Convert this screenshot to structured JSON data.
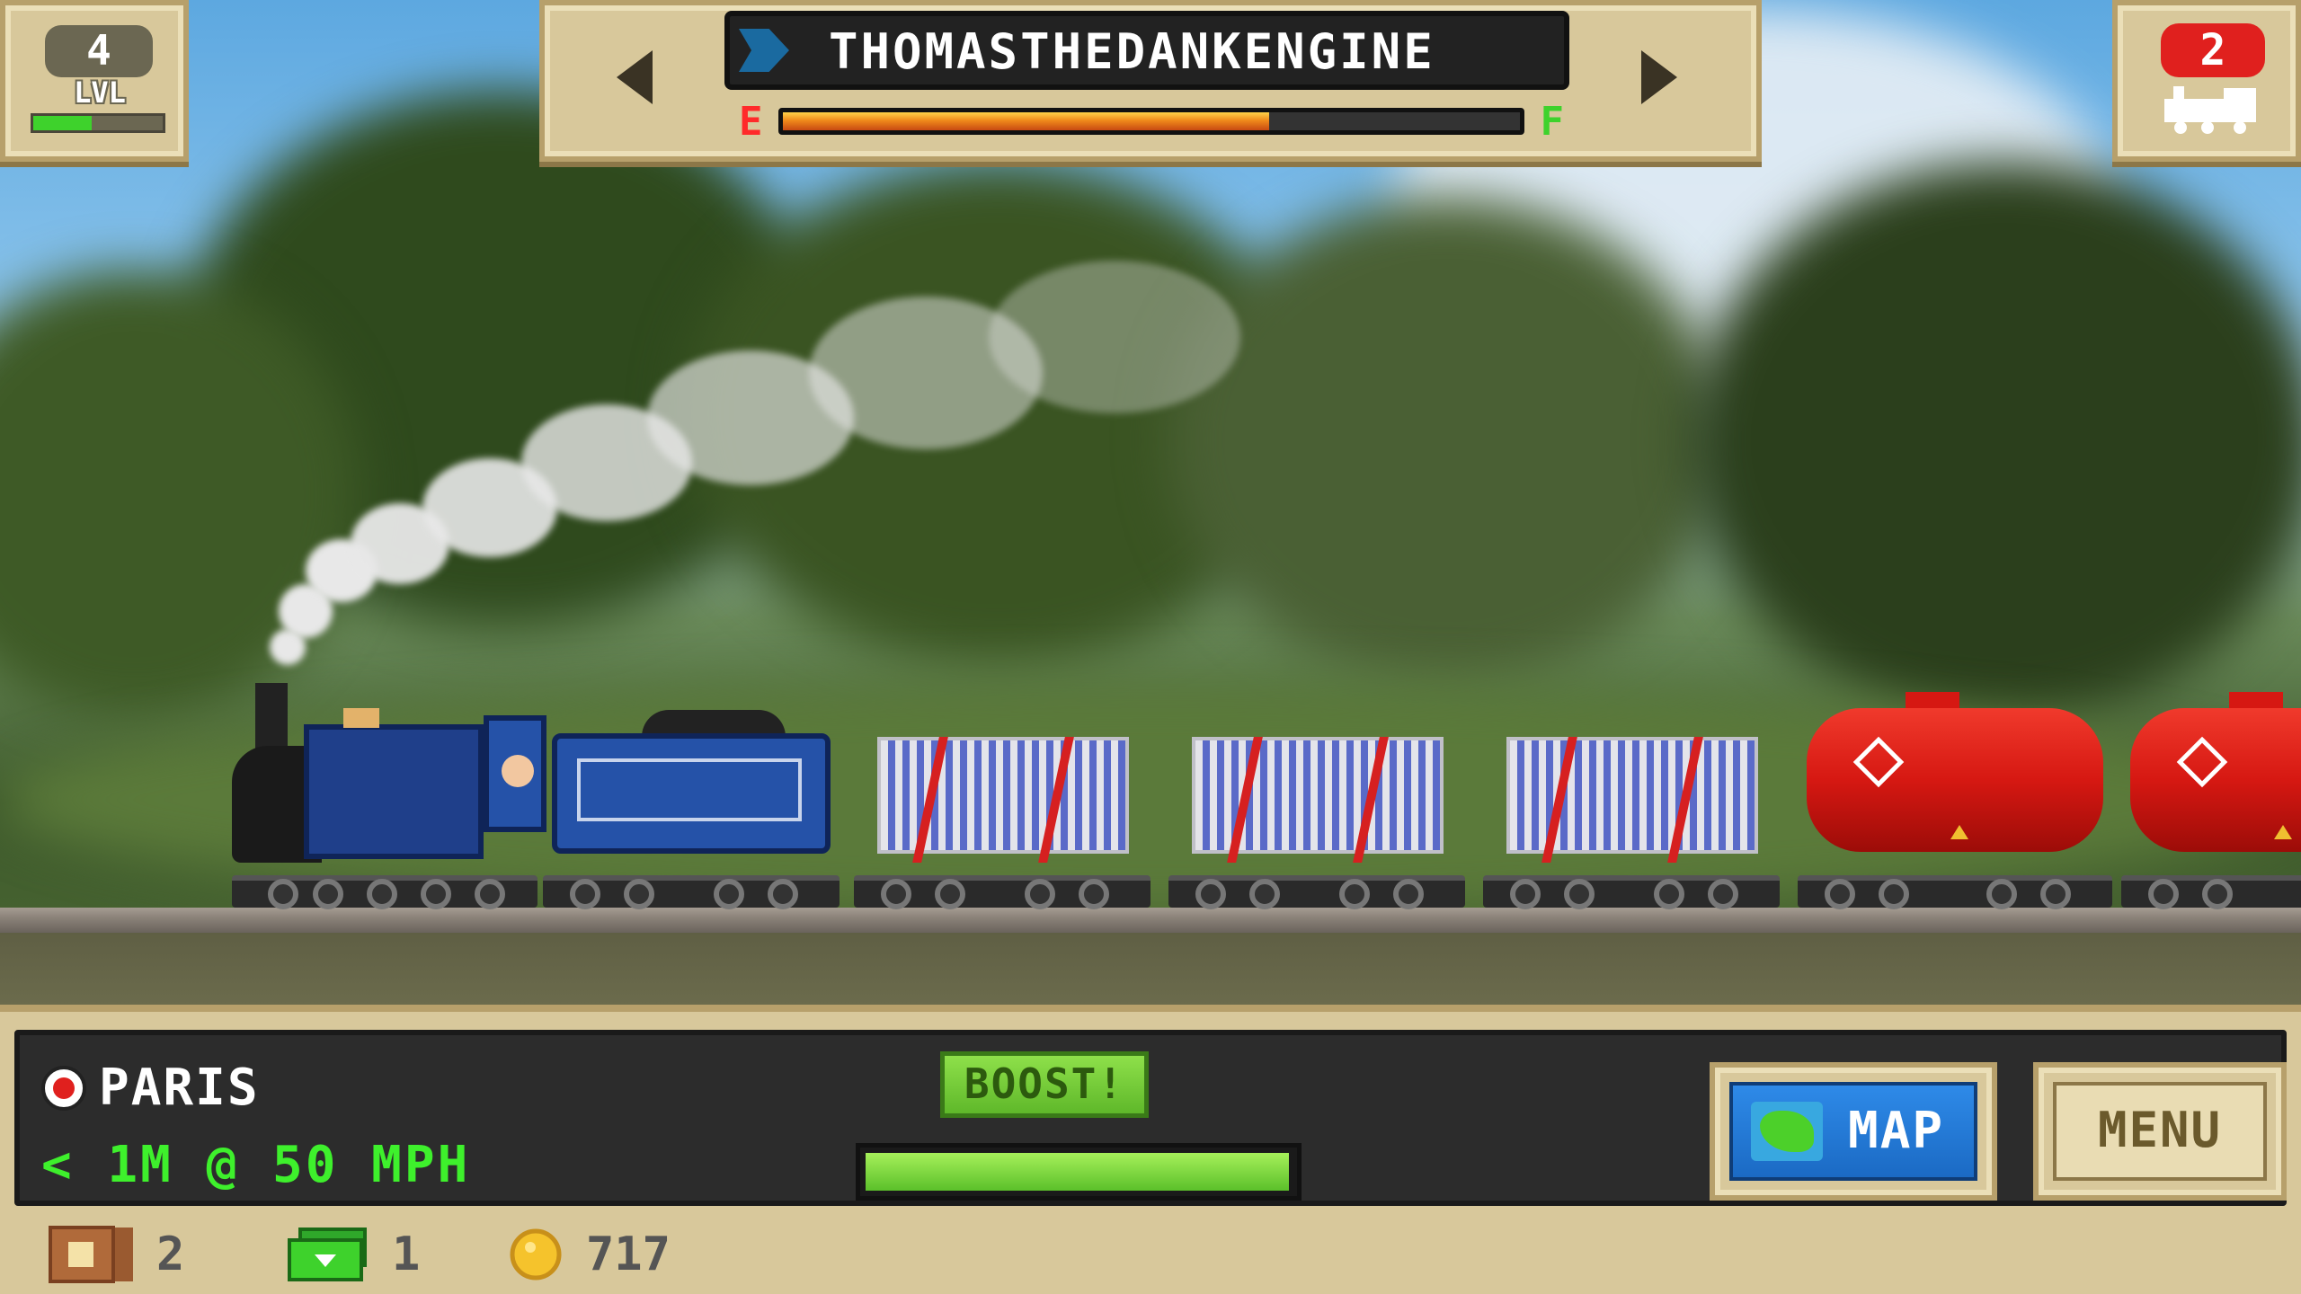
{
  "level": {
    "value": "4",
    "label": "LVL",
    "progress": 0.45
  },
  "train": {
    "name": "THOMASTHEDANKENGINE",
    "fuel_empty_label": "E",
    "fuel_full_label": "F",
    "fuel_level": 0.66
  },
  "train_count": {
    "value": "2"
  },
  "destination": {
    "name": "PARIS",
    "status": "< 1M @ 50 MPH"
  },
  "boost": {
    "label": "BOOST!",
    "level": 0.97
  },
  "buttons": {
    "map_label": "MAP",
    "menu_label": "MENU"
  },
  "resources": {
    "crates": "2",
    "cash": "1",
    "coins": "717"
  },
  "colors": {
    "engine": "#1f3f8a",
    "tanker": "#d61812",
    "hud": "#d8c89b",
    "boost": "#5fb82a"
  }
}
